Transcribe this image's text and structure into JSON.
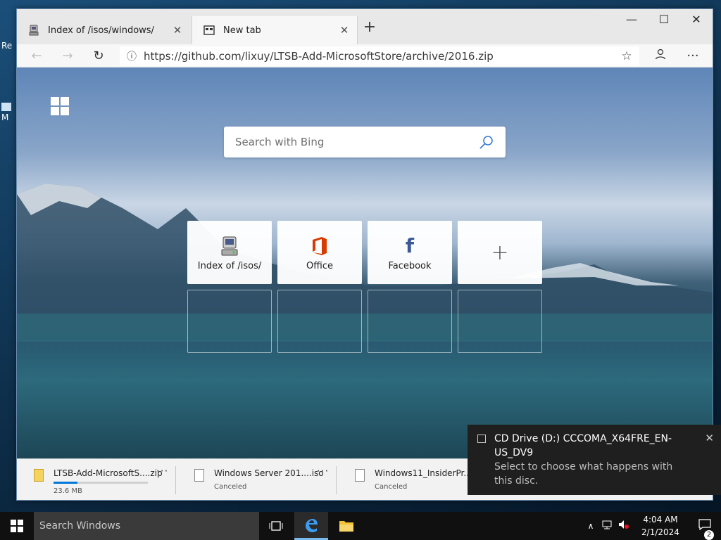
{
  "desktop": {
    "icons": [
      {
        "label": "Re"
      },
      {
        "label": "M"
      }
    ]
  },
  "browser": {
    "tabs": [
      {
        "label": "Index of /isos/windows/",
        "active": false,
        "icon": "server-icon"
      },
      {
        "label": "New tab",
        "active": true,
        "icon": "newtab-icon"
      }
    ],
    "new_tab_symbol": "+",
    "window_controls": {
      "minimize": "—",
      "maximize": "☐",
      "close": "✕"
    },
    "address": {
      "url": "https://github.com/lixuy/LTSB-Add-MicrosoftStore/archive/2016.zip"
    },
    "toolbar": {
      "more": "···"
    }
  },
  "ntp": {
    "search_placeholder": "Search with Bing",
    "top_sites": [
      {
        "label": "Index of /isos/",
        "icon": "server-icon"
      },
      {
        "label": "Office",
        "icon": "office-icon",
        "color": "#d83b01"
      },
      {
        "label": "Facebook",
        "icon": "facebook-icon",
        "color": "#3b5998"
      },
      {
        "label": "",
        "icon": "add-icon"
      }
    ]
  },
  "downloads": [
    {
      "name": "LTSB-Add-MicrosoftS....zip",
      "status": "23.6 MB",
      "progress": 0.25,
      "type": "zip"
    },
    {
      "name": "Windows Server 201....iso",
      "status": "Canceled",
      "type": "iso"
    },
    {
      "name": "Windows11_InsiderPr....iso",
      "status": "Canceled",
      "type": "iso"
    }
  ],
  "toast": {
    "title": "CD Drive (D:) CCCOMA_X64FRE_EN-US_DV9",
    "body": "Select to choose what happens with this disc.",
    "close": "✕"
  },
  "taskbar": {
    "search_placeholder": "Search Windows",
    "time": "4:04 AM",
    "date": "2/1/2024",
    "notification_count": "2",
    "accent": "#0078d7"
  }
}
